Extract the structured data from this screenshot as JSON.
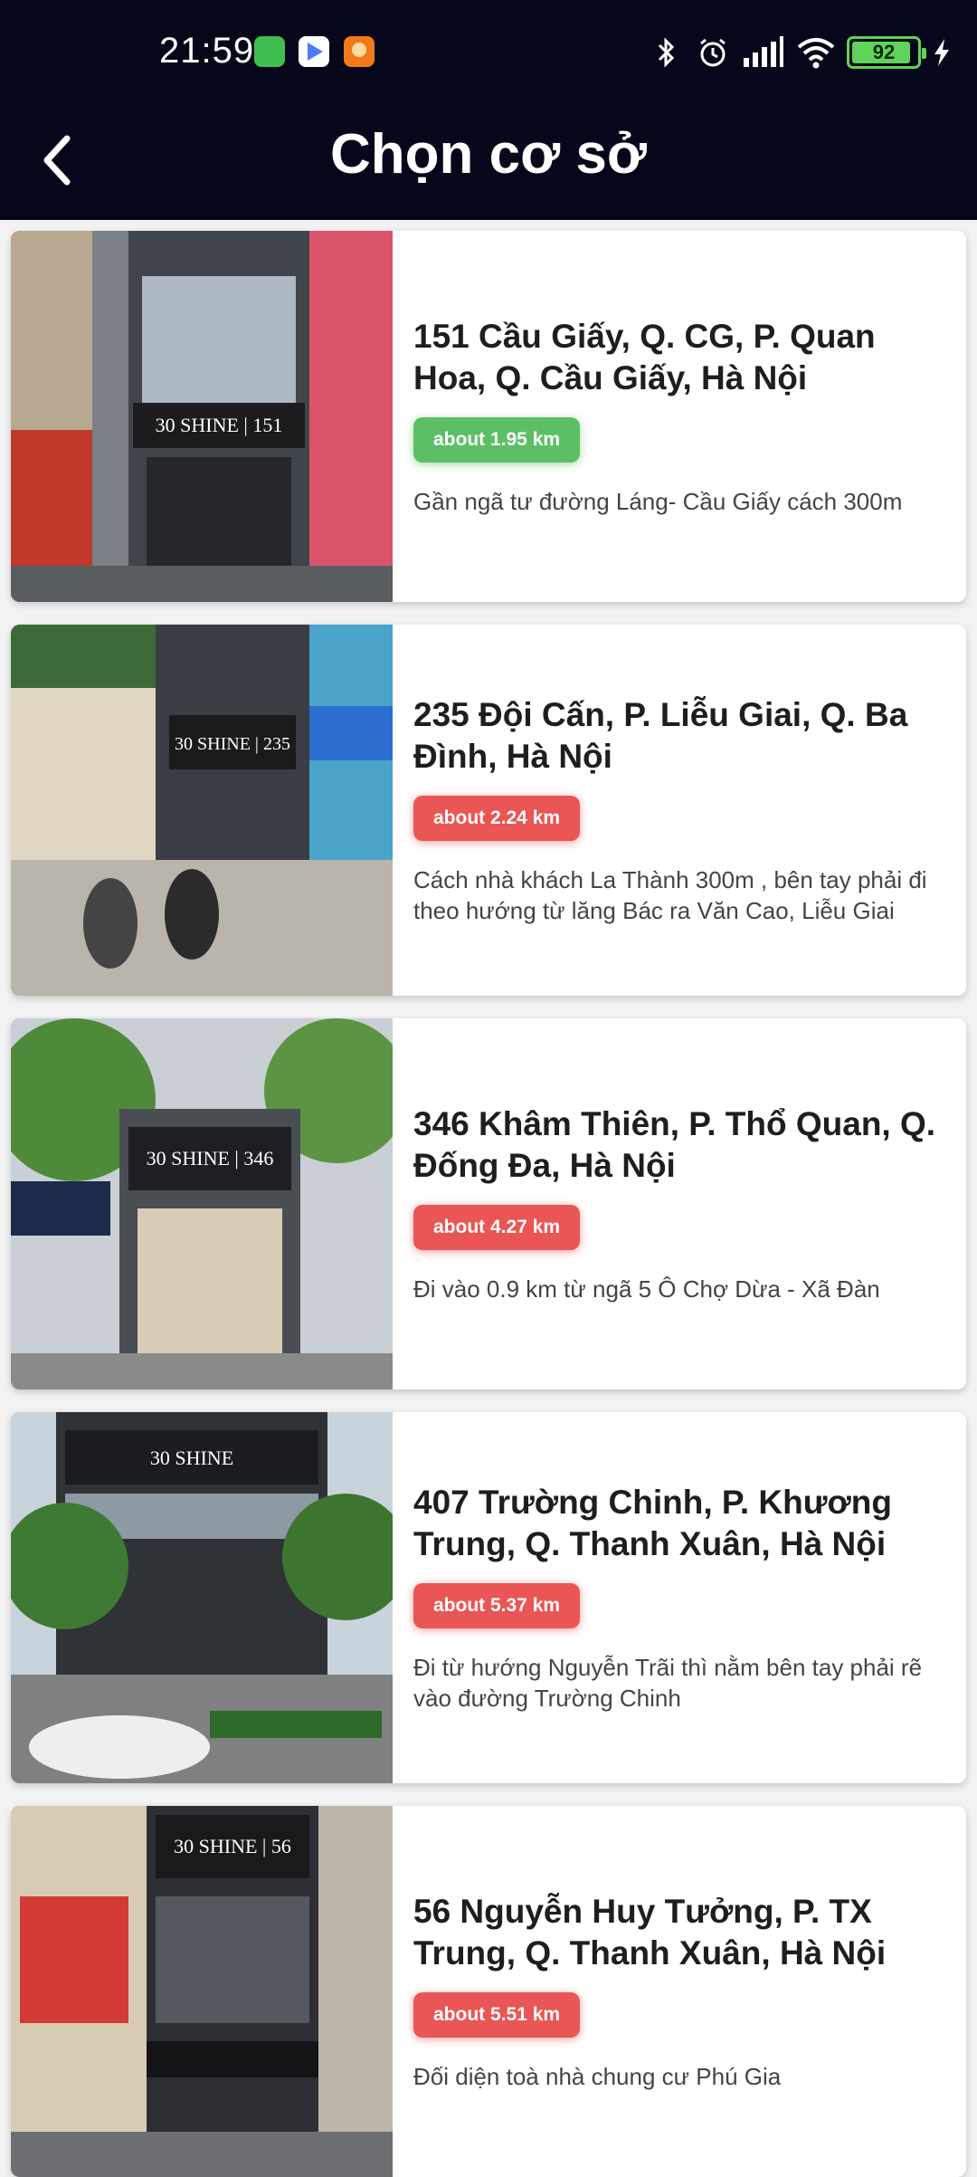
{
  "status_bar": {
    "time": "21:59",
    "battery": "92",
    "battery_fraction": 0.92,
    "icons": [
      "app-notification-icon",
      "play-store-icon",
      "app-notification-icon",
      "bluetooth-icon",
      "alarm-icon",
      "signal-icon",
      "wifi-icon",
      "charging-icon"
    ]
  },
  "header": {
    "title": "Chọn cơ sở",
    "back_icon": "chevron-left-icon"
  },
  "colors": {
    "header_bg": "#06071a",
    "badge_green": "#5cbf66",
    "badge_red": "#ea5555"
  },
  "locations": [
    {
      "address": "151 Cầu Giấy, Q. CG, P. Quan Hoa, Q. Cầu Giấy, Hà Nội",
      "distance": "about 1.95 km",
      "distance_color": "green",
      "note": "Gần ngã tư đường Láng- Cầu Giấy cách 300m",
      "photo_sign": "30 SHINE | 151"
    },
    {
      "address": "235 Đội Cấn, P. Liễu Giai, Q. Ba Đình, Hà Nội",
      "distance": "about 2.24 km",
      "distance_color": "red",
      "note": "Cách nhà khách La Thành 300m , bên tay phải đi theo hướng từ lăng Bác ra Văn Cao, Liễu Giai",
      "photo_sign": "30 SHINE | 235"
    },
    {
      "address": "346 Khâm Thiên, P. Thổ Quan, Q. Đống Đa, Hà Nội",
      "distance": "about 4.27 km",
      "distance_color": "red",
      "note": "Đi vào 0.9 km từ ngã 5 Ô Chợ Dừa - Xã Đàn",
      "photo_sign": "30 SHINE | 346"
    },
    {
      "address": "407 Trường Chinh, P. Khương Trung, Q. Thanh Xuân, Hà Nội",
      "distance": "about 5.37 km",
      "distance_color": "red",
      "note": "Đi từ hướng Nguyễn Trãi thì nằm bên tay phải rẽ vào đường Trường Chinh",
      "photo_sign": "30 SHINE"
    },
    {
      "address": "56 Nguyễn Huy Tưởng, P. TX Trung, Q. Thanh Xuân, Hà Nội",
      "distance": "about 5.51 km",
      "distance_color": "red",
      "note": "Đối diện toà nhà chung cư Phú Gia",
      "photo_sign": "30 SHINE | 56"
    }
  ]
}
